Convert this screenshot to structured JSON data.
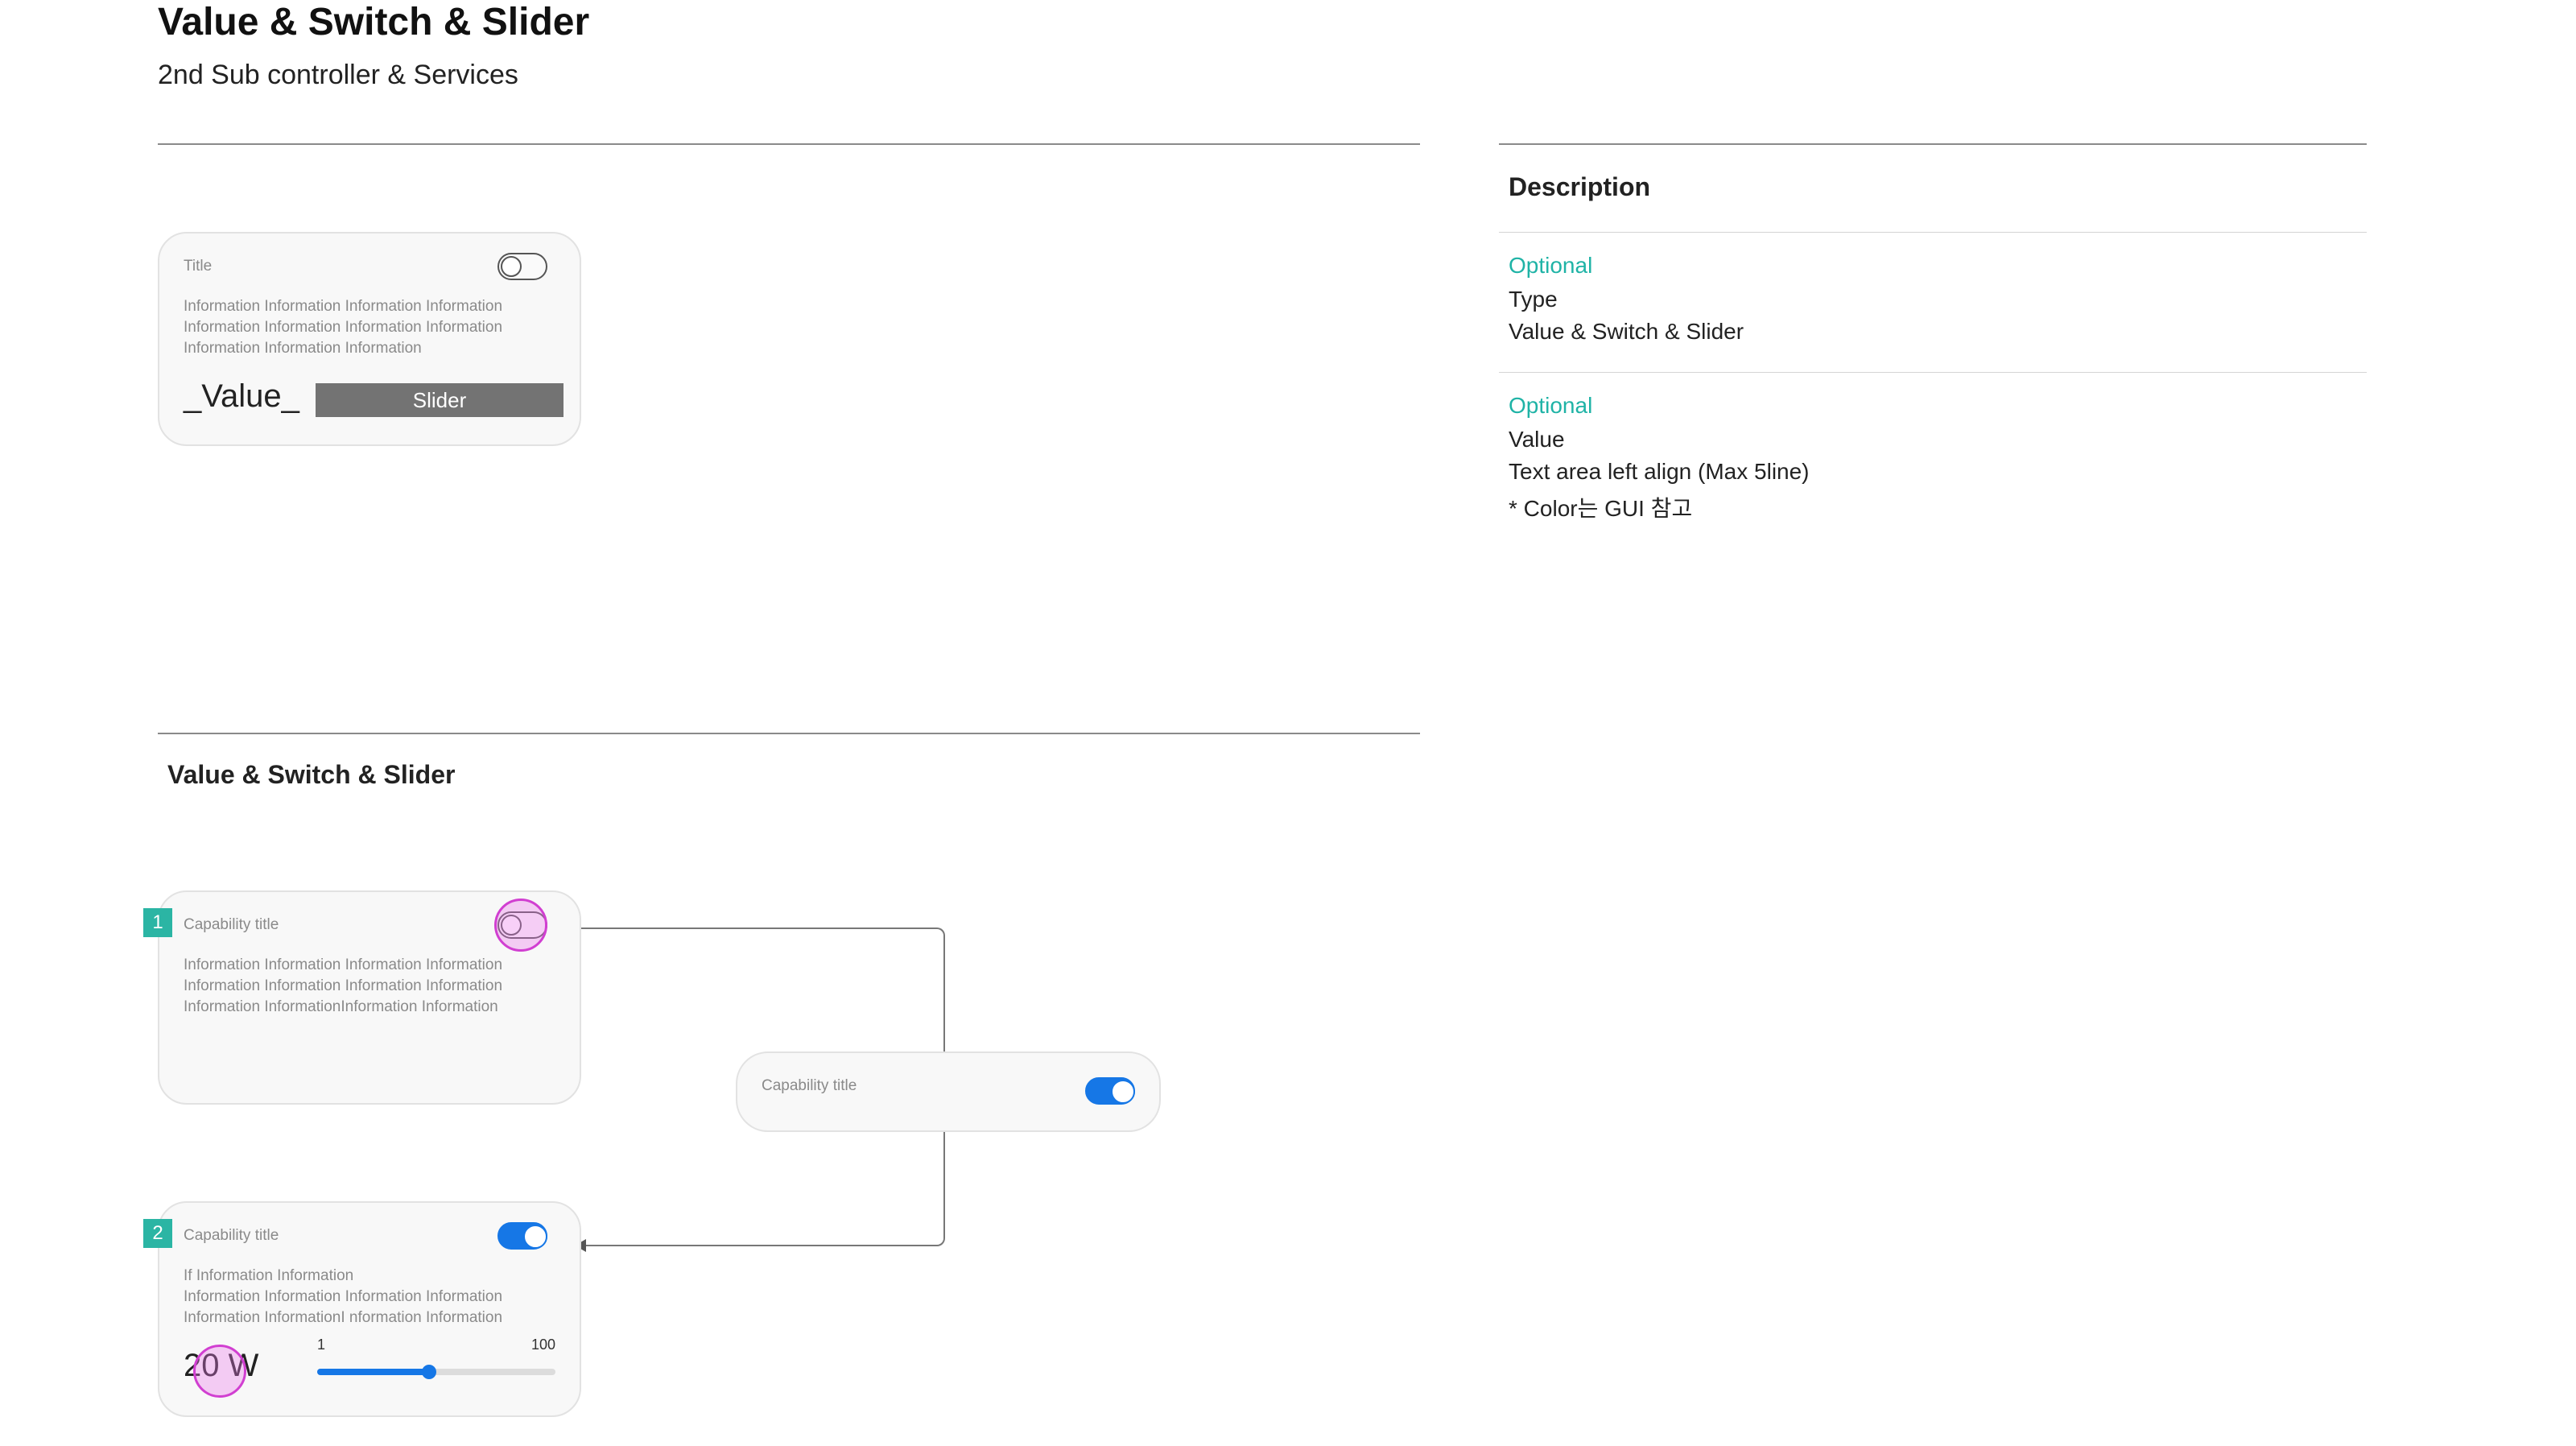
{
  "header": {
    "title": "Value & Switch & Slider",
    "subtitle": "2nd Sub controller & Services"
  },
  "preview_card": {
    "title": "Title",
    "info_lines": [
      "Information Information Information Information",
      "Information Information Information Information",
      "Information Information Information"
    ],
    "value": "_Value_",
    "slider_label": "Slider",
    "switch_state": "off"
  },
  "description": {
    "header": "Description",
    "blocks": [
      {
        "tag": "Optional",
        "lines": [
          "Type",
          "Value & Switch & Slider"
        ]
      },
      {
        "tag": "Optional",
        "lines": [
          "Value",
          "Text area left align (Max 5line)",
          "* Color는 GUI 참고"
        ]
      }
    ]
  },
  "section": {
    "title": "Value & Switch & Slider"
  },
  "flow": {
    "card1": {
      "badge": "1",
      "title": "Capability title",
      "info_lines": [
        "Information Information Information Information",
        "Information Information Information Information",
        "Information InformationInformation Information"
      ],
      "switch_state": "off"
    },
    "popup": {
      "title": "Capability title",
      "switch_state": "on"
    },
    "card2": {
      "badge": "2",
      "title": "Capability title",
      "info_lines": [
        "If Information Information",
        "Information Information Information Information",
        "Information InformationI nformation Information"
      ],
      "switch_state": "on",
      "value": "20 W",
      "slider_min": "1",
      "slider_max": "100",
      "slider_fraction": 0.47
    }
  },
  "colors": {
    "accent_teal": "#1fb3a6",
    "switch_on_blue": "#1677e6",
    "touch_highlight": "#d13fd1"
  }
}
